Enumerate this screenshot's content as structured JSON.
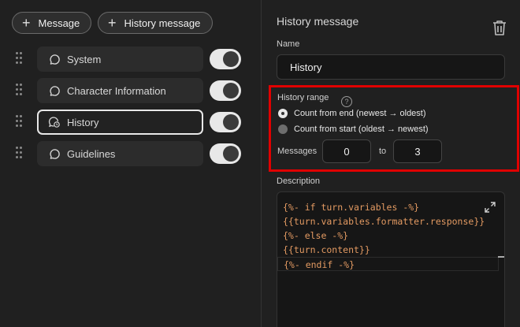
{
  "toolbar": {
    "add_message_label": "Message",
    "add_history_message_label": "History message"
  },
  "messages": [
    {
      "label": "System",
      "icon": "chat-bubble-icon",
      "enabled": true,
      "selected": false
    },
    {
      "label": "Character Information",
      "icon": "chat-bubble-icon",
      "enabled": true,
      "selected": false
    },
    {
      "label": "History",
      "icon": "history-bubble-icon",
      "enabled": true,
      "selected": true
    },
    {
      "label": "Guidelines",
      "icon": "chat-bubble-icon",
      "enabled": true,
      "selected": false
    }
  ],
  "panel": {
    "title": "History message",
    "name_label": "Name",
    "name_value": "History",
    "history_range": {
      "label": "History range",
      "help_symbol": "?",
      "options": [
        {
          "label": "Count from end (newest → oldest)",
          "selected": true
        },
        {
          "label": "Count from start (oldest → newest)",
          "selected": false
        }
      ],
      "messages_label": "Messages",
      "from_value": "0",
      "to_label": "to",
      "to_value": "3"
    },
    "description_label": "Description",
    "description_lines": [
      "{%- if turn.variables -%}",
      "{{turn.variables.formatter.response}}",
      "{%- else -%}",
      "{{turn.content}}",
      "{%- endif -%}"
    ]
  },
  "colors": {
    "background": "#202020",
    "highlight_border": "#e00000",
    "code_text": "#e39a62",
    "toggle_on": "#e8e8e8"
  }
}
